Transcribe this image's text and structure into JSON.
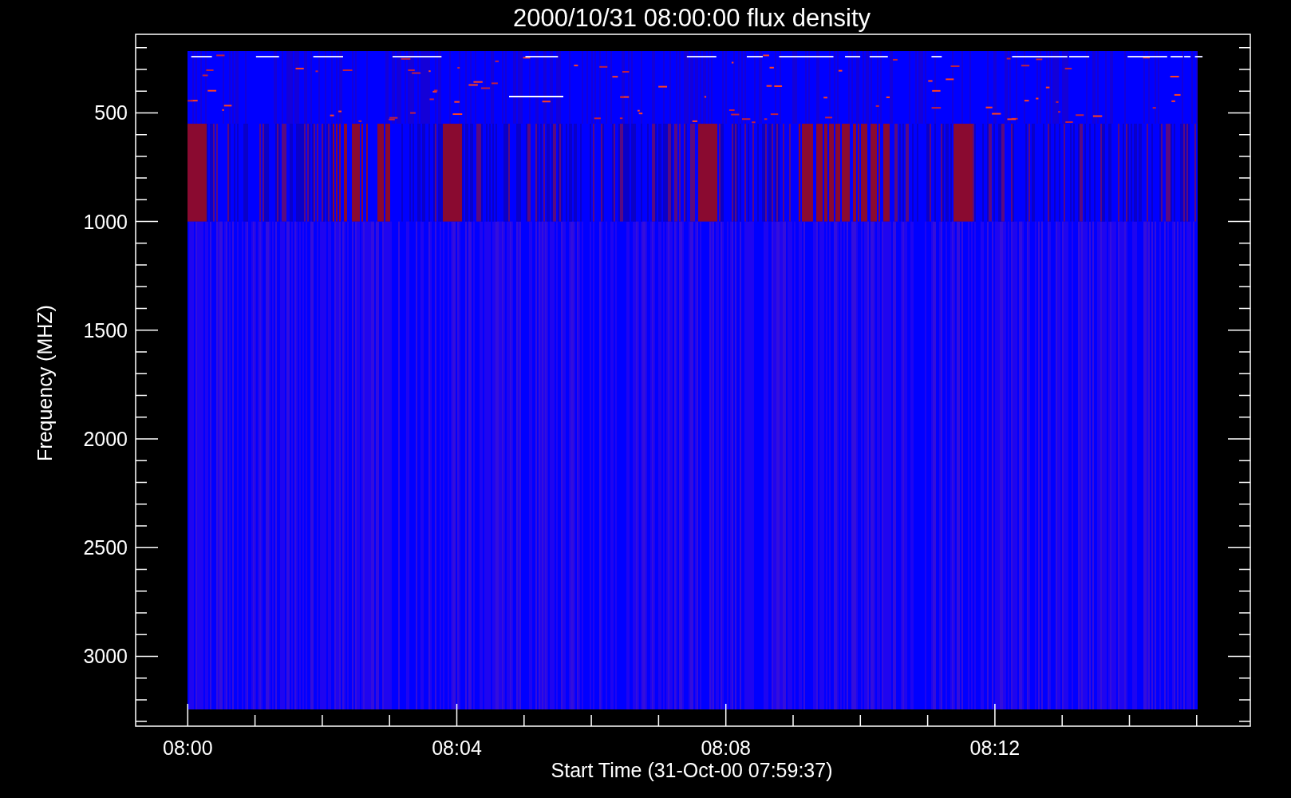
{
  "title": "2000/10/31 08:00:00 flux density",
  "ylabel": "Frequency (MHZ)",
  "xlabel": "Start Time (31-Oct-00 07:59:37)",
  "yticks": [
    "500",
    "1000",
    "1500",
    "2000",
    "2500",
    "3000"
  ],
  "xticks": [
    "08:00",
    "08:04",
    "08:08",
    "08:12"
  ]
}
